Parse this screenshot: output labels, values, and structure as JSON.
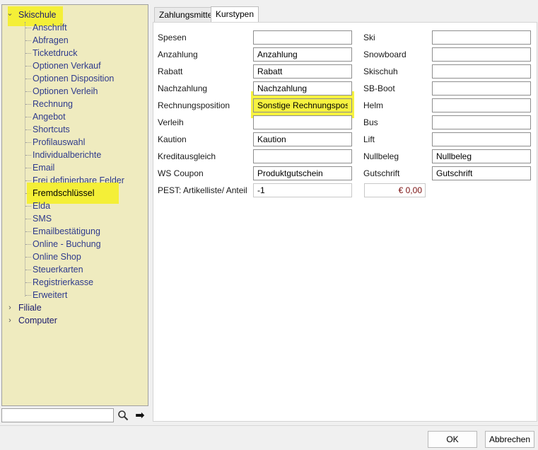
{
  "tree": {
    "root": "Skischule",
    "children": [
      "Anschrift",
      "Abfragen",
      "Ticketdruck",
      "Optionen Verkauf",
      "Optionen Disposition",
      "Optionen Verleih",
      "Rechnung",
      "Angebot",
      "Shortcuts",
      "Profilauswahl",
      "Individualberichte",
      "Email",
      "Frei definierbare Felder",
      "Fremdschlüssel",
      "Elda",
      "SMS",
      "Emailbestätigung",
      "Online - Buchung",
      "Online Shop",
      "Steuerkarten",
      "Registrierkasse",
      "Erweitert"
    ],
    "selected": "Fremdschlüssel",
    "other_roots": [
      "Filiale",
      "Computer"
    ]
  },
  "search": {
    "value": "",
    "search_icon": "magnifier-icon",
    "go_icon": "arrow-right-icon",
    "go_glyph": "➡"
  },
  "tabs": [
    "Zahlungsmittel",
    "Kurstypen"
  ],
  "active_tab": "Kurstypen",
  "form": {
    "left": [
      {
        "label": "Spesen",
        "value": ""
      },
      {
        "label": "Anzahlung",
        "value": "Anzahlung"
      },
      {
        "label": "Rabatt",
        "value": "Rabatt"
      },
      {
        "label": "Nachzahlung",
        "value": "Nachzahlung"
      },
      {
        "label": "Rechnungsposition",
        "value": "Sonstige Rechnungspos"
      },
      {
        "label": "Verleih",
        "value": ""
      },
      {
        "label": "Kaution",
        "value": "Kaution"
      },
      {
        "label": "Kreditausgleich",
        "value": ""
      },
      {
        "label": "WS Coupon",
        "value": "Produktgutschein"
      }
    ],
    "right": [
      {
        "label": "Ski",
        "value": ""
      },
      {
        "label": "Snowboard",
        "value": ""
      },
      {
        "label": "Skischuh",
        "value": ""
      },
      {
        "label": "SB-Boot",
        "value": ""
      },
      {
        "label": "Helm",
        "value": ""
      },
      {
        "label": "Bus",
        "value": ""
      },
      {
        "label": "Lift",
        "value": ""
      },
      {
        "label": "Nullbeleg",
        "value": "Nullbeleg"
      },
      {
        "label": "Gutschrift",
        "value": "Gutschrift"
      }
    ],
    "pest": {
      "label": "PEST: Artikelliste/ Anteil",
      "value": "-1",
      "amount": "€ 0,00"
    }
  },
  "buttons": {
    "ok": "OK",
    "cancel": "Abbrechen"
  },
  "colors": {
    "tree_bg": "#efebbf",
    "highlight": "#f5f23a",
    "tree_text": "#2e3a8c",
    "amount": "#7a1010"
  }
}
